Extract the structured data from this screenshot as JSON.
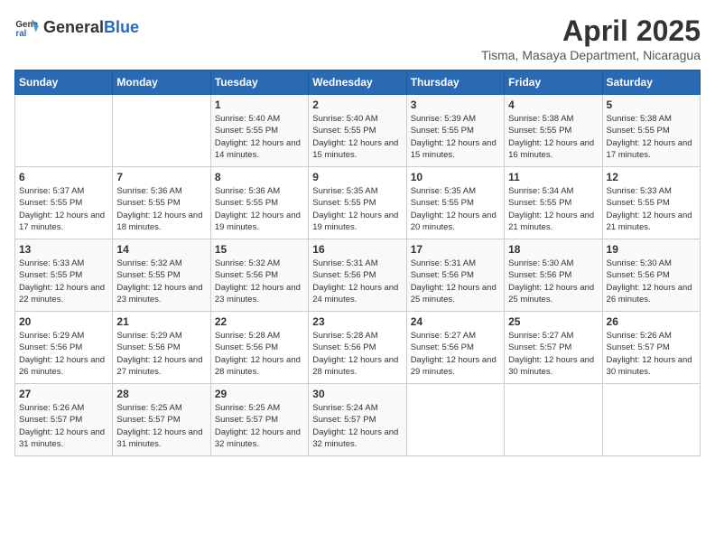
{
  "header": {
    "logo_general": "General",
    "logo_blue": "Blue",
    "month": "April 2025",
    "location": "Tisma, Masaya Department, Nicaragua"
  },
  "weekdays": [
    "Sunday",
    "Monday",
    "Tuesday",
    "Wednesday",
    "Thursday",
    "Friday",
    "Saturday"
  ],
  "weeks": [
    [
      {
        "day": "",
        "info": ""
      },
      {
        "day": "",
        "info": ""
      },
      {
        "day": "1",
        "info": "Sunrise: 5:40 AM\nSunset: 5:55 PM\nDaylight: 12 hours and 14 minutes."
      },
      {
        "day": "2",
        "info": "Sunrise: 5:40 AM\nSunset: 5:55 PM\nDaylight: 12 hours and 15 minutes."
      },
      {
        "day": "3",
        "info": "Sunrise: 5:39 AM\nSunset: 5:55 PM\nDaylight: 12 hours and 15 minutes."
      },
      {
        "day": "4",
        "info": "Sunrise: 5:38 AM\nSunset: 5:55 PM\nDaylight: 12 hours and 16 minutes."
      },
      {
        "day": "5",
        "info": "Sunrise: 5:38 AM\nSunset: 5:55 PM\nDaylight: 12 hours and 17 minutes."
      }
    ],
    [
      {
        "day": "6",
        "info": "Sunrise: 5:37 AM\nSunset: 5:55 PM\nDaylight: 12 hours and 17 minutes."
      },
      {
        "day": "7",
        "info": "Sunrise: 5:36 AM\nSunset: 5:55 PM\nDaylight: 12 hours and 18 minutes."
      },
      {
        "day": "8",
        "info": "Sunrise: 5:36 AM\nSunset: 5:55 PM\nDaylight: 12 hours and 19 minutes."
      },
      {
        "day": "9",
        "info": "Sunrise: 5:35 AM\nSunset: 5:55 PM\nDaylight: 12 hours and 19 minutes."
      },
      {
        "day": "10",
        "info": "Sunrise: 5:35 AM\nSunset: 5:55 PM\nDaylight: 12 hours and 20 minutes."
      },
      {
        "day": "11",
        "info": "Sunrise: 5:34 AM\nSunset: 5:55 PM\nDaylight: 12 hours and 21 minutes."
      },
      {
        "day": "12",
        "info": "Sunrise: 5:33 AM\nSunset: 5:55 PM\nDaylight: 12 hours and 21 minutes."
      }
    ],
    [
      {
        "day": "13",
        "info": "Sunrise: 5:33 AM\nSunset: 5:55 PM\nDaylight: 12 hours and 22 minutes."
      },
      {
        "day": "14",
        "info": "Sunrise: 5:32 AM\nSunset: 5:55 PM\nDaylight: 12 hours and 23 minutes."
      },
      {
        "day": "15",
        "info": "Sunrise: 5:32 AM\nSunset: 5:56 PM\nDaylight: 12 hours and 23 minutes."
      },
      {
        "day": "16",
        "info": "Sunrise: 5:31 AM\nSunset: 5:56 PM\nDaylight: 12 hours and 24 minutes."
      },
      {
        "day": "17",
        "info": "Sunrise: 5:31 AM\nSunset: 5:56 PM\nDaylight: 12 hours and 25 minutes."
      },
      {
        "day": "18",
        "info": "Sunrise: 5:30 AM\nSunset: 5:56 PM\nDaylight: 12 hours and 25 minutes."
      },
      {
        "day": "19",
        "info": "Sunrise: 5:30 AM\nSunset: 5:56 PM\nDaylight: 12 hours and 26 minutes."
      }
    ],
    [
      {
        "day": "20",
        "info": "Sunrise: 5:29 AM\nSunset: 5:56 PM\nDaylight: 12 hours and 26 minutes."
      },
      {
        "day": "21",
        "info": "Sunrise: 5:29 AM\nSunset: 5:56 PM\nDaylight: 12 hours and 27 minutes."
      },
      {
        "day": "22",
        "info": "Sunrise: 5:28 AM\nSunset: 5:56 PM\nDaylight: 12 hours and 28 minutes."
      },
      {
        "day": "23",
        "info": "Sunrise: 5:28 AM\nSunset: 5:56 PM\nDaylight: 12 hours and 28 minutes."
      },
      {
        "day": "24",
        "info": "Sunrise: 5:27 AM\nSunset: 5:56 PM\nDaylight: 12 hours and 29 minutes."
      },
      {
        "day": "25",
        "info": "Sunrise: 5:27 AM\nSunset: 5:57 PM\nDaylight: 12 hours and 30 minutes."
      },
      {
        "day": "26",
        "info": "Sunrise: 5:26 AM\nSunset: 5:57 PM\nDaylight: 12 hours and 30 minutes."
      }
    ],
    [
      {
        "day": "27",
        "info": "Sunrise: 5:26 AM\nSunset: 5:57 PM\nDaylight: 12 hours and 31 minutes."
      },
      {
        "day": "28",
        "info": "Sunrise: 5:25 AM\nSunset: 5:57 PM\nDaylight: 12 hours and 31 minutes."
      },
      {
        "day": "29",
        "info": "Sunrise: 5:25 AM\nSunset: 5:57 PM\nDaylight: 12 hours and 32 minutes."
      },
      {
        "day": "30",
        "info": "Sunrise: 5:24 AM\nSunset: 5:57 PM\nDaylight: 12 hours and 32 minutes."
      },
      {
        "day": "",
        "info": ""
      },
      {
        "day": "",
        "info": ""
      },
      {
        "day": "",
        "info": ""
      }
    ]
  ]
}
